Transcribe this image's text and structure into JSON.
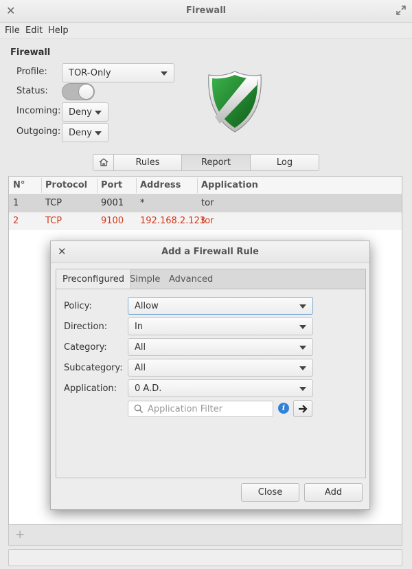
{
  "window": {
    "title": "Firewall"
  },
  "menu": {
    "file": "File",
    "edit": "Edit",
    "help": "Help"
  },
  "firewall": {
    "section_title": "Firewall",
    "profile_label": "Profile:",
    "profile_value": "TOR-Only",
    "status_label": "Status:",
    "status_on": true,
    "incoming_label": "Incoming:",
    "incoming_value": "Deny",
    "outgoing_label": "Outgoing:",
    "outgoing_value": "Deny"
  },
  "tabs": {
    "rules": "Rules",
    "report": "Report",
    "log": "Log",
    "active": "Report"
  },
  "table": {
    "columns": [
      "N°",
      "Protocol",
      "Port",
      "Address",
      "Application"
    ],
    "rows": [
      {
        "n": "1",
        "protocol": "TCP",
        "port": "9001",
        "address": "*",
        "application": "tor"
      },
      {
        "n": "2",
        "protocol": "TCP",
        "port": "9100",
        "address": "192.168.2.123",
        "application": "tor"
      }
    ]
  },
  "toolbar": {
    "add_symbol": "+"
  },
  "dialog": {
    "title": "Add a Firewall Rule",
    "tabs": {
      "preconfigured": "Preconfigured",
      "simple": "Simple",
      "advanced": "Advanced"
    },
    "policy_label": "Policy:",
    "policy_value": "Allow",
    "direction_label": "Direction:",
    "direction_value": "In",
    "category_label": "Category:",
    "category_value": "All",
    "subcategory_label": "Subcategory:",
    "subcategory_value": "All",
    "application_label": "Application:",
    "application_value": "0 A.D.",
    "filter_placeholder": "Application Filter",
    "close_button": "Close",
    "add_button": "Add"
  },
  "colors": {
    "accent_red": "#d0391c",
    "shield_green": "#1f8a2e",
    "info_blue": "#2f82d6"
  }
}
